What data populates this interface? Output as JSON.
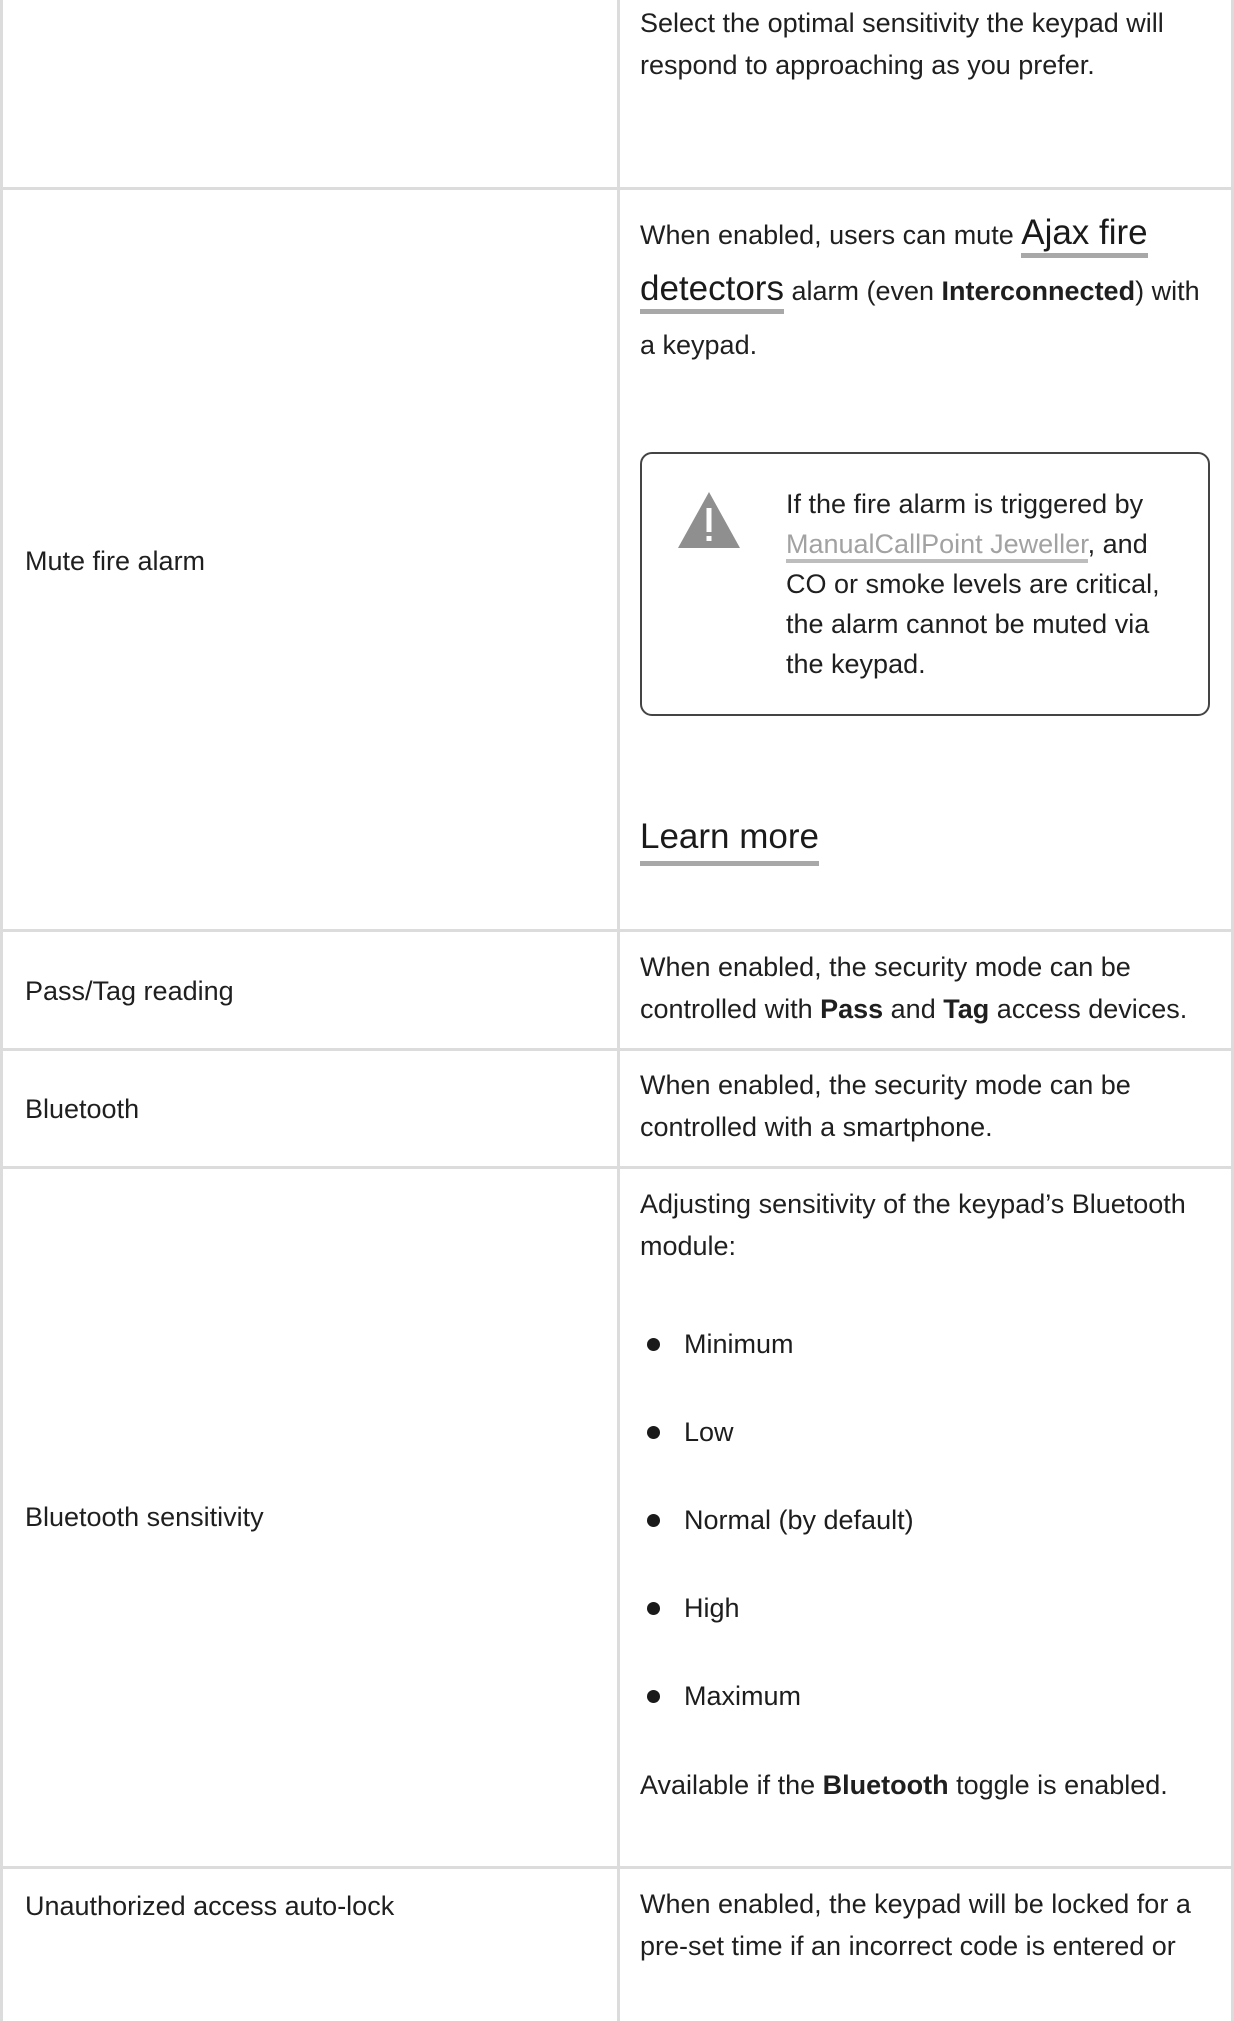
{
  "rows": [
    {
      "label": "",
      "description": "Select the optimal sensitivity the keypad will respond to approaching as you prefer."
    },
    {
      "label": "Mute fire alarm",
      "description_before": "When enabled, users can mute ",
      "description_link": "Ajax fire detectors",
      "description_mid": " alarm (even ",
      "description_bold": "Interconnected",
      "description_after": ") with a keypad.",
      "callout": {
        "icon": "warning-icon",
        "text_before": "If the fire alarm is triggered by ",
        "link": "ManualCallPoint Jeweller",
        "text_after": ", and CO or smoke levels are critical, the alarm cannot be muted via the keypad."
      },
      "learn_more": "Learn more"
    },
    {
      "label": "Pass/Tag reading",
      "text1": "When enabled, the security mode can be controlled with ",
      "bold1": "Pass",
      "text2": " and ",
      "bold2": "Tag",
      "text3": " access devices."
    },
    {
      "label": "Bluetooth",
      "description": "When enabled, the security mode can be controlled with a smartphone."
    },
    {
      "label": "Bluetooth sensitivity",
      "intro": "Adjusting sensitivity of the keypad’s Bluetooth module:",
      "options": [
        "Minimum",
        "Low",
        "Normal (by default)",
        "High",
        "Maximum"
      ],
      "footer_before": "Available if the ",
      "footer_bold": "Bluetooth",
      "footer_after": " toggle is enabled."
    },
    {
      "label": "Unauthorized access auto-lock",
      "description": "When enabled, the keypad will be locked for a pre-set time if an incorrect code is entered or"
    }
  ],
  "colors": {
    "grid": "#dcdcdc",
    "text": "#1f1f1f",
    "link_underline": "#a8a8a8",
    "muted_link": "#a2a2a2",
    "warning_icon": "#8f8f8f"
  }
}
